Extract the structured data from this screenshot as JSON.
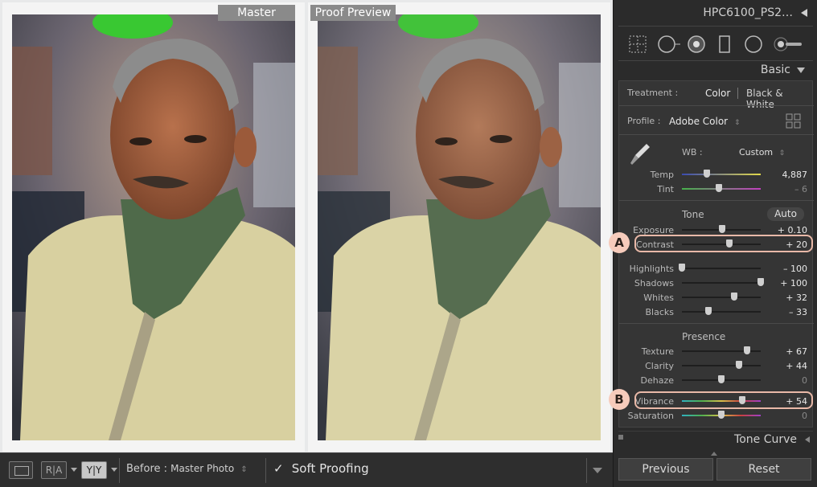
{
  "compare": {
    "left_label": "Master",
    "right_label": "Proof Preview"
  },
  "toolbar": {
    "ra_label": "R|A",
    "yy_label": "Y|Y",
    "before_label": "Before :",
    "before_value": "Master Photo",
    "soft_proofing_label": "Soft Proofing",
    "soft_proofing_checked": true
  },
  "panel": {
    "title": "HPC6100_PS2…",
    "basic_title": "Basic",
    "treatment_label": "Treatment :",
    "treatment_color": "Color",
    "treatment_bw": "Black & White",
    "profile_label": "Profile :",
    "profile_value": "Adobe Color",
    "wb_label": "WB :",
    "wb_value": "Custom",
    "temp_label": "Temp",
    "temp_value": "4,887",
    "temp_level": 0.32,
    "tint_label": "Tint",
    "tint_value": "– 6",
    "tint_level": 0.47,
    "tone_label": "Tone",
    "auto_label": "Auto",
    "exposure_label": "Exposure",
    "exposure_value": "+ 0.10",
    "exposure_level": 0.51,
    "contrast_label": "Contrast",
    "contrast_value": "+ 20",
    "contrast_level": 0.6,
    "highlights_label": "Highlights",
    "highlights_value": "– 100",
    "highlights_level": 0.0,
    "shadows_label": "Shadows",
    "shadows_value": "+ 100",
    "shadows_level": 1.0,
    "whites_label": "Whites",
    "whites_value": "+ 32",
    "whites_level": 0.66,
    "blacks_label": "Blacks",
    "blacks_value": "– 33",
    "blacks_level": 0.34,
    "presence_label": "Presence",
    "texture_label": "Texture",
    "texture_value": "+ 67",
    "texture_level": 0.83,
    "clarity_label": "Clarity",
    "clarity_value": "+ 44",
    "clarity_level": 0.72,
    "dehaze_label": "Dehaze",
    "dehaze_value": "0",
    "dehaze_level": 0.5,
    "vibrance_label": "Vibrance",
    "vibrance_value": "+ 54",
    "vibrance_level": 0.77,
    "saturation_label": "Saturation",
    "saturation_value": "0",
    "saturation_level": 0.5,
    "callout_a": "A",
    "callout_b": "B",
    "tone_curve_title": "Tone Curve",
    "previous_label": "Previous",
    "reset_label": "Reset"
  },
  "colors": {
    "callout_fill": "#f6cbbb",
    "highlight_border": "#e9b9a8"
  }
}
